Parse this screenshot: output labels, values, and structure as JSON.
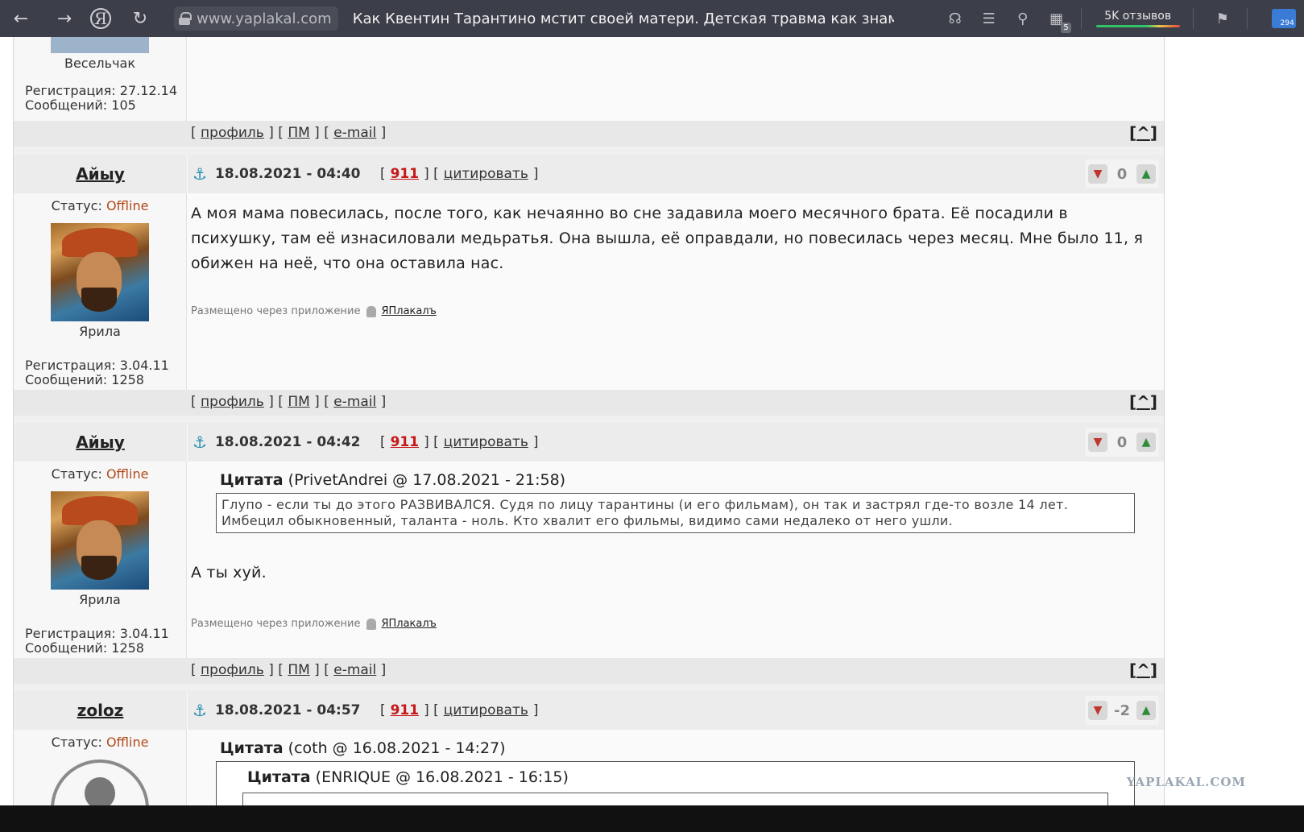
{
  "browser": {
    "url": "www.yaplakal.com",
    "title": "Как Квентин Тарантино мстит своей матери. Детская травма как знамя -...",
    "reviews": "5K отзывов",
    "tab_badge": "5",
    "apps_badge": "294"
  },
  "top_partial": {
    "rank": "Весельчак",
    "reg": "Регистрация: 27.12.14",
    "posts": "Сообщений: 105"
  },
  "foot": {
    "profile": "профиль",
    "pm": "ПМ",
    "email": "e-mail",
    "top": "^"
  },
  "labels": {
    "status": "Статус:",
    "offline": "Offline",
    "via": "Размещено через приложение",
    "app": "ЯПлакалъ",
    "n911": "911",
    "quote": "цитировать",
    "quote_word": "Цитата"
  },
  "posts": [
    {
      "user": "Айыу",
      "date": "18.08.2021 - 04:40",
      "votes": "0",
      "rank": "Ярила",
      "reg": "Регистрация: 3.04.11",
      "count": "Сообщений: 1258",
      "text": "А моя мама повесилась, после того, как нечаянно во сне задавила моего месячного брата. Её посадили в психушку, там её изнасиловали медьратья. Она вышла, её оправдали, но повесилась через месяц. Мне было 11, я обижен на неё, что она оставила нас."
    },
    {
      "user": "Айыу",
      "date": "18.08.2021 - 04:42",
      "votes": "0",
      "rank": "Ярила",
      "reg": "Регистрация: 3.04.11",
      "count": "Сообщений: 1258",
      "quote_meta": "(PrivetAndrei @ 17.08.2021 - 21:58)",
      "quote_text": "Глупо - если ты до этого РАЗВИВАЛСЯ. Судя по лицу тарантины (и его фильмам), он так и застрял где-то возле 14 лет. Имбецил обыкновенный, таланта - ноль. Кто хвалит его фильмы, видимо сами недалеко от него ушли.",
      "text": "А ты хуй."
    },
    {
      "user": "zoloz",
      "date": "18.08.2021 - 04:57",
      "votes": "-2",
      "quote_meta": "(coth @ 16.08.2021 - 14:27)",
      "nested_quote_meta": "(ENRIQUE @ 16.08.2021 - 16:15)"
    }
  ],
  "watermark": "YAPLAKAL.COM"
}
